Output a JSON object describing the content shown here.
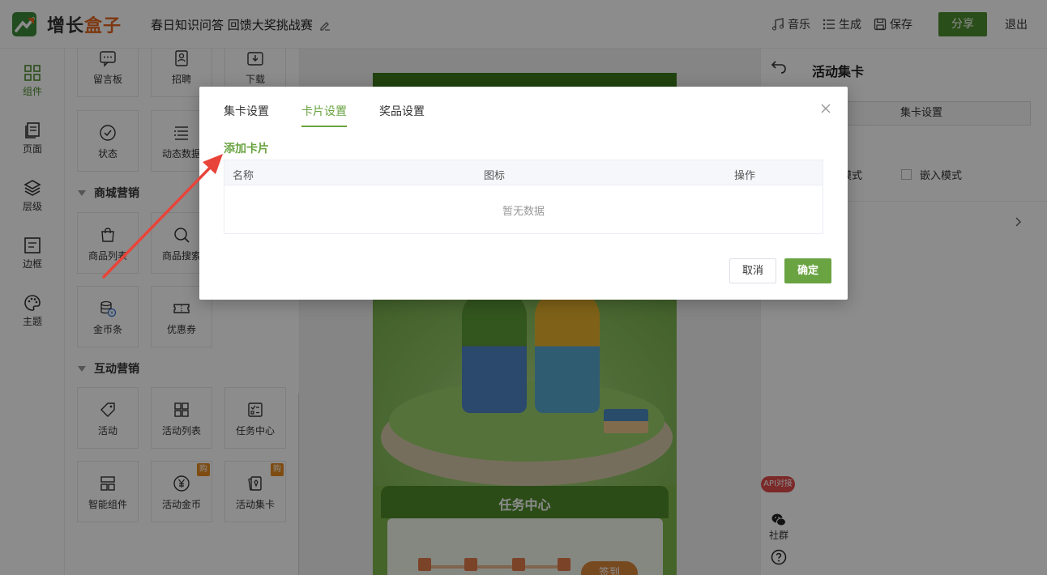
{
  "header": {
    "logo_text_a": "增长",
    "logo_text_b": "盒子",
    "title": "春日知识问答 回馈大奖挑战赛",
    "music": "音乐",
    "generate": "生成",
    "save": "保存",
    "share": "分享",
    "exit": "退出",
    "accent": "#4e8f2e"
  },
  "rail": {
    "items": [
      {
        "label": "组件",
        "icon": "grid-icon"
      },
      {
        "label": "页面",
        "icon": "pages-icon"
      },
      {
        "label": "层级",
        "icon": "layers-icon"
      },
      {
        "label": "边框",
        "icon": "border-icon"
      },
      {
        "label": "主题",
        "icon": "palette-icon"
      }
    ]
  },
  "panel": {
    "row1": [
      "留言板",
      "招聘",
      "下载"
    ],
    "row2": [
      "状态",
      "动态数据"
    ],
    "section_mall": "商城营销",
    "row3": [
      "商品列表",
      "商品搜索"
    ],
    "row4": [
      "金币条",
      "优惠券"
    ],
    "section_interact": "互动营销",
    "row5": [
      "活动",
      "活动列表",
      "任务中心"
    ],
    "row6": [
      "智能组件",
      "活动金币",
      "活动集卡"
    ],
    "buy_badge": "购"
  },
  "canvas": {
    "task_center": "任务中心",
    "checkin": "签到"
  },
  "tools": {
    "api": "API对接",
    "community": "社群"
  },
  "right_panel": {
    "title": "活动集卡",
    "settings_tab": "集卡设置",
    "mode_label": "式",
    "mode_a": "浮模式",
    "mode_b": "嵌入模式"
  },
  "dialog": {
    "tabs": [
      "集卡设置",
      "卡片设置",
      "奖品设置"
    ],
    "active_tab": "卡片设置",
    "add_card": "添加卡片",
    "columns": [
      "名称",
      "图标",
      "操作"
    ],
    "empty": "暂无数据",
    "cancel": "取消",
    "confirm": "确定",
    "accent": "#6aa442"
  }
}
